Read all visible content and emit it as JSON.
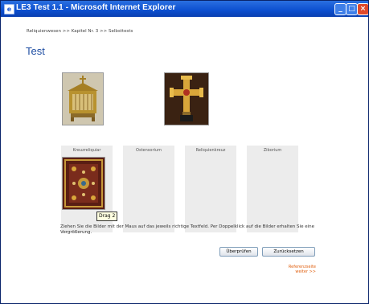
{
  "window": {
    "title": "LE3 Test 1.1 - Microsoft Internet Explorer",
    "icon": "ie-icon",
    "controls": {
      "minimize": "_",
      "maximize": "□",
      "close": "×"
    }
  },
  "breadcrumb": "Reliquienwesen >> Kapitel Nr. 3 >> Selbsttests",
  "page_title": "Test",
  "drop_zones": [
    {
      "label": "Kreuzreliquiar"
    },
    {
      "label": "Ostensorium"
    },
    {
      "label": "Reliquienkreuz"
    },
    {
      "label": "Ziborium"
    }
  ],
  "drag_tooltip": "Drag 2",
  "instructions": "Ziehen Sie die Bilder mit der Maus auf das jeweils richtige Textfeld. Per Doppelklick auf die Bilder erhalten Sie eine Vergrößerung.",
  "buttons": {
    "check": "Überprüfen",
    "reset": "Zurücksetzen"
  },
  "reference_link": {
    "line1": "Referenzseite",
    "line2": "weiter >>"
  }
}
